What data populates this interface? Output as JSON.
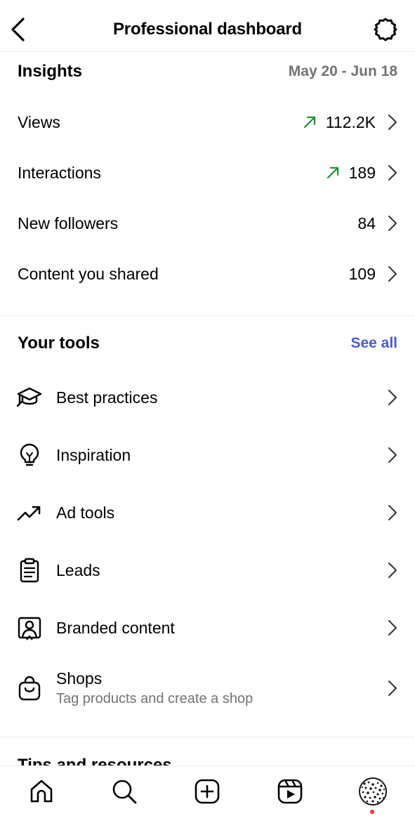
{
  "header": {
    "title": "Professional dashboard",
    "back_icon": "chevron-left-icon",
    "settings_icon": "gear-icon"
  },
  "insights": {
    "title": "Insights",
    "date_range": "May 20 - Jun 18",
    "trend_color": "#1f8f3a",
    "rows": [
      {
        "label": "Views",
        "value": "112.2K",
        "trend": "up"
      },
      {
        "label": "Interactions",
        "value": "189",
        "trend": "up"
      },
      {
        "label": "New followers",
        "value": "84",
        "trend": ""
      },
      {
        "label": "Content you shared",
        "value": "109",
        "trend": ""
      }
    ]
  },
  "tools": {
    "title": "Your tools",
    "see_all": "See all",
    "accent_color": "#4a5bd4",
    "items": [
      {
        "label": "Best practices",
        "icon": "graduation-cap-icon"
      },
      {
        "label": "Inspiration",
        "icon": "lightbulb-icon"
      },
      {
        "label": "Ad tools",
        "icon": "trend-up-icon"
      },
      {
        "label": "Leads",
        "icon": "clipboard-icon"
      },
      {
        "label": "Branded content",
        "icon": "branded-content-icon"
      },
      {
        "label": "Shops",
        "sublabel": "Tag products and create a shop",
        "icon": "shopping-bag-icon"
      }
    ]
  },
  "next_section": {
    "title": "Tips and resources"
  },
  "bottom_nav": {
    "items": [
      "home-icon",
      "search-icon",
      "create-icon",
      "reels-icon",
      "profile-avatar"
    ],
    "notification_color": "#ff3040"
  }
}
